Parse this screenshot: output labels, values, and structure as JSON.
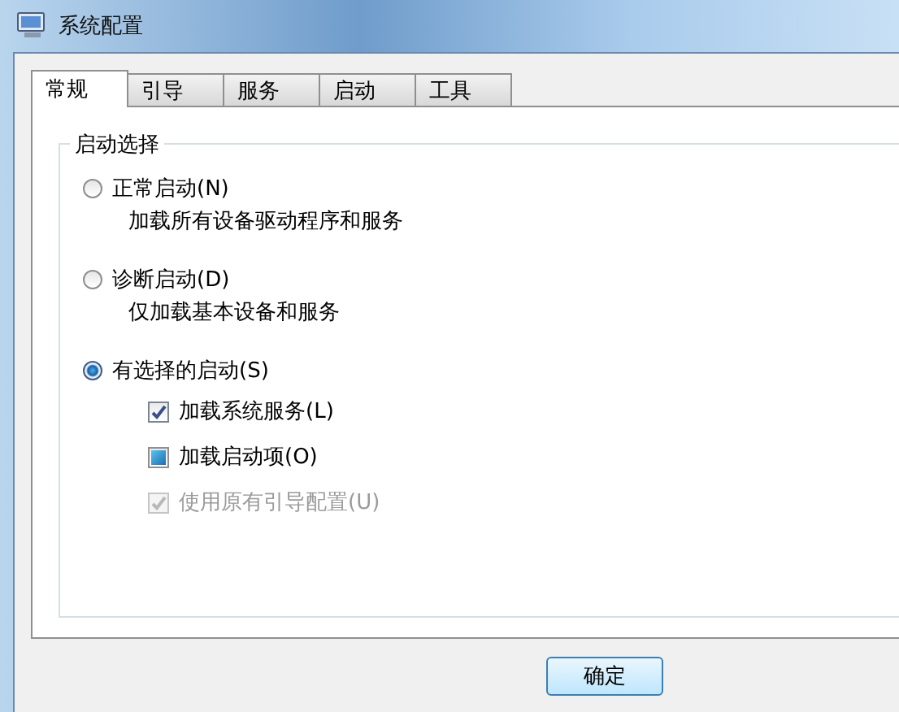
{
  "window": {
    "title": "系统配置"
  },
  "tabs": [
    {
      "label": "常规",
      "selected": true
    },
    {
      "label": "引导",
      "selected": false
    },
    {
      "label": "服务",
      "selected": false
    },
    {
      "label": "启动",
      "selected": false
    },
    {
      "label": "工具",
      "selected": false
    }
  ],
  "group": {
    "title": "启动选择",
    "options": [
      {
        "label": "正常启动(N)",
        "description": "加载所有设备驱动程序和服务",
        "selected": false
      },
      {
        "label": "诊断启动(D)",
        "description": "仅加载基本设备和服务",
        "selected": false
      },
      {
        "label": "有选择的启动(S)",
        "selected": true,
        "checkboxes": [
          {
            "label": "加载系统服务(L)",
            "checked": true,
            "disabled": false
          },
          {
            "label": "加载启动项(O)",
            "checked": false,
            "indeterminate": true,
            "disabled": false
          },
          {
            "label": "使用原有引导配置(U)",
            "checked": true,
            "disabled": true
          }
        ]
      }
    ]
  },
  "buttons": [
    {
      "label": "确定"
    }
  ]
}
